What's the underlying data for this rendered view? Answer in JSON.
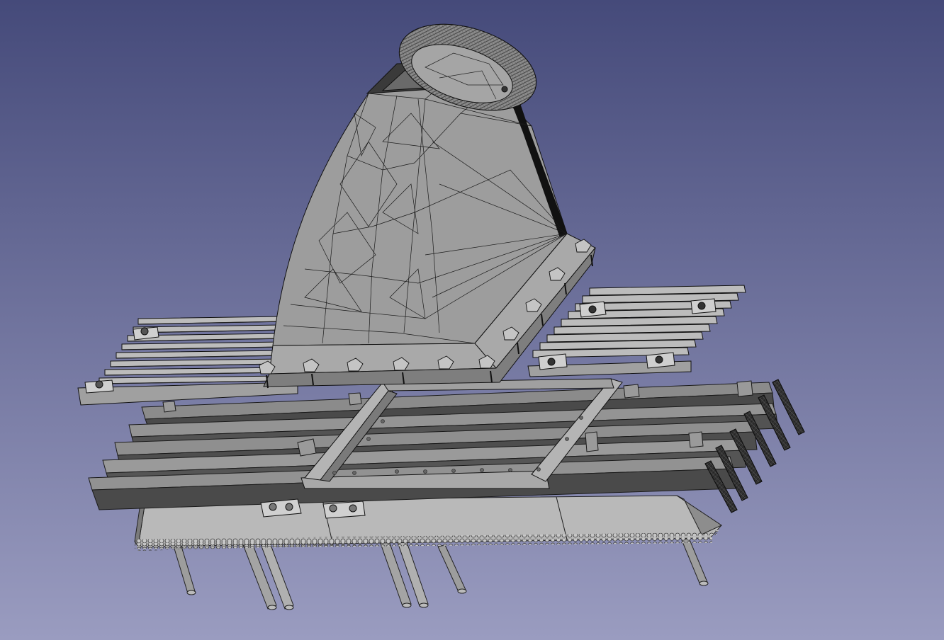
{
  "viewport": {
    "background_top": "#454a7a",
    "background_bottom": "#9a9cc0"
  },
  "model": {
    "render_style": "flat-lines",
    "face_color": "#9a9a9a",
    "dark_face_color": "#5a5a5a",
    "edge_color": "#000000",
    "parts": [
      "hopper-funnel",
      "round-flange",
      "left-grate",
      "right-grate",
      "base-frame",
      "channel-beams",
      "trough",
      "support-legs",
      "rotated-bar-stack"
    ]
  }
}
